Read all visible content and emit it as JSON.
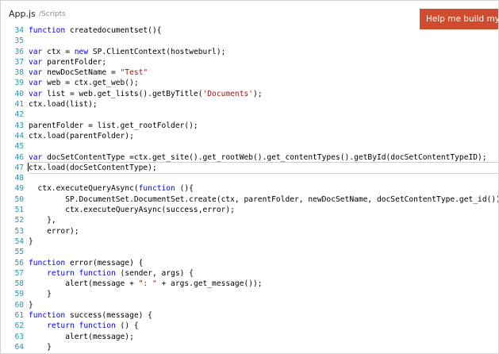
{
  "editor": {
    "file_name": "App.js",
    "file_path": "/Scripts",
    "help_button_label": "Help me build my Sha",
    "lines": [
      {
        "n": "34",
        "parts": [
          [
            "kw",
            "function"
          ],
          [
            "p",
            " createdocumentset(){"
          ]
        ]
      },
      {
        "n": "35",
        "parts": []
      },
      {
        "n": "36",
        "parts": [
          [
            "kw",
            "var"
          ],
          [
            "p",
            " ctx = "
          ],
          [
            "kw",
            "new"
          ],
          [
            "p",
            " SP.ClientContext(hostweburl);"
          ]
        ]
      },
      {
        "n": "37",
        "parts": [
          [
            "kw",
            "var"
          ],
          [
            "p",
            " parentFolder;"
          ]
        ]
      },
      {
        "n": "38",
        "parts": [
          [
            "kw",
            "var"
          ],
          [
            "p",
            " newDocSetName = "
          ],
          [
            "str",
            "\"Test\""
          ]
        ]
      },
      {
        "n": "39",
        "parts": [
          [
            "kw",
            "var"
          ],
          [
            "p",
            " web = ctx.get_web();"
          ]
        ]
      },
      {
        "n": "40",
        "parts": [
          [
            "kw",
            "var"
          ],
          [
            "p",
            " list = web.get_lists().getByTitle("
          ],
          [
            "str",
            "'Documents'"
          ],
          [
            "p",
            ");"
          ]
        ]
      },
      {
        "n": "41",
        "parts": [
          [
            "p",
            "ctx.load(list);"
          ]
        ]
      },
      {
        "n": "42",
        "parts": []
      },
      {
        "n": "43",
        "parts": [
          [
            "p",
            "parentFolder = list.get_rootFolder();"
          ]
        ]
      },
      {
        "n": "44",
        "parts": [
          [
            "p",
            "ctx.load(parentFolder);"
          ]
        ]
      },
      {
        "n": "45",
        "parts": []
      },
      {
        "n": "46",
        "parts": [
          [
            "kw",
            "var"
          ],
          [
            "p",
            " docSetContentType =ctx.get_site().get_rootWeb().get_contentTypes().getById(docSetContentTypeID);"
          ]
        ]
      },
      {
        "n": "47",
        "parts": [
          [
            "p",
            "ctx.load(docSetContentType);"
          ]
        ],
        "current": true
      },
      {
        "n": "48",
        "parts": []
      },
      {
        "n": "49",
        "parts": [
          [
            "p",
            "  ctx.executeQueryAsync("
          ],
          [
            "kw",
            "function"
          ],
          [
            "p",
            " (){"
          ]
        ]
      },
      {
        "n": "50",
        "parts": [
          [
            "p",
            "        SP.DocumentSet.DocumentSet.create(ctx, parentFolder, newDocSetName, docSetContentType.get_id());"
          ]
        ]
      },
      {
        "n": "51",
        "parts": [
          [
            "p",
            "        ctx.executeQueryAsync(success,error);"
          ]
        ]
      },
      {
        "n": "52",
        "parts": [
          [
            "p",
            "    },"
          ]
        ]
      },
      {
        "n": "53",
        "parts": [
          [
            "p",
            "    error);"
          ]
        ]
      },
      {
        "n": "54",
        "parts": [
          [
            "p",
            "}"
          ]
        ]
      },
      {
        "n": "55",
        "parts": []
      },
      {
        "n": "56",
        "parts": [
          [
            "kw",
            "function"
          ],
          [
            "p",
            " error(message) {"
          ]
        ]
      },
      {
        "n": "57",
        "parts": [
          [
            "p",
            "    "
          ],
          [
            "kw",
            "return"
          ],
          [
            "p",
            " "
          ],
          [
            "kw",
            "function"
          ],
          [
            "p",
            " (sender, args) {"
          ]
        ]
      },
      {
        "n": "58",
        "parts": [
          [
            "p",
            "        alert(message + "
          ],
          [
            "str",
            "\": \""
          ],
          [
            "p",
            " + args.get_message());"
          ]
        ]
      },
      {
        "n": "59",
        "parts": [
          [
            "p",
            "    }"
          ]
        ]
      },
      {
        "n": "60",
        "parts": [
          [
            "p",
            "}"
          ]
        ]
      },
      {
        "n": "61",
        "parts": [
          [
            "kw",
            "function"
          ],
          [
            "p",
            " success(message) {"
          ]
        ]
      },
      {
        "n": "62",
        "parts": [
          [
            "p",
            "    "
          ],
          [
            "kw",
            "return"
          ],
          [
            "p",
            " "
          ],
          [
            "kw",
            "function"
          ],
          [
            "p",
            " () {"
          ]
        ]
      },
      {
        "n": "63",
        "parts": [
          [
            "p",
            "        alert(message);"
          ]
        ]
      },
      {
        "n": "64",
        "parts": [
          [
            "p",
            "    }"
          ]
        ]
      }
    ]
  },
  "colors": {
    "keyword": "#0000ff",
    "string": "#a31515",
    "line_number": "#2b91af",
    "help_button": "#cf4d2e"
  }
}
